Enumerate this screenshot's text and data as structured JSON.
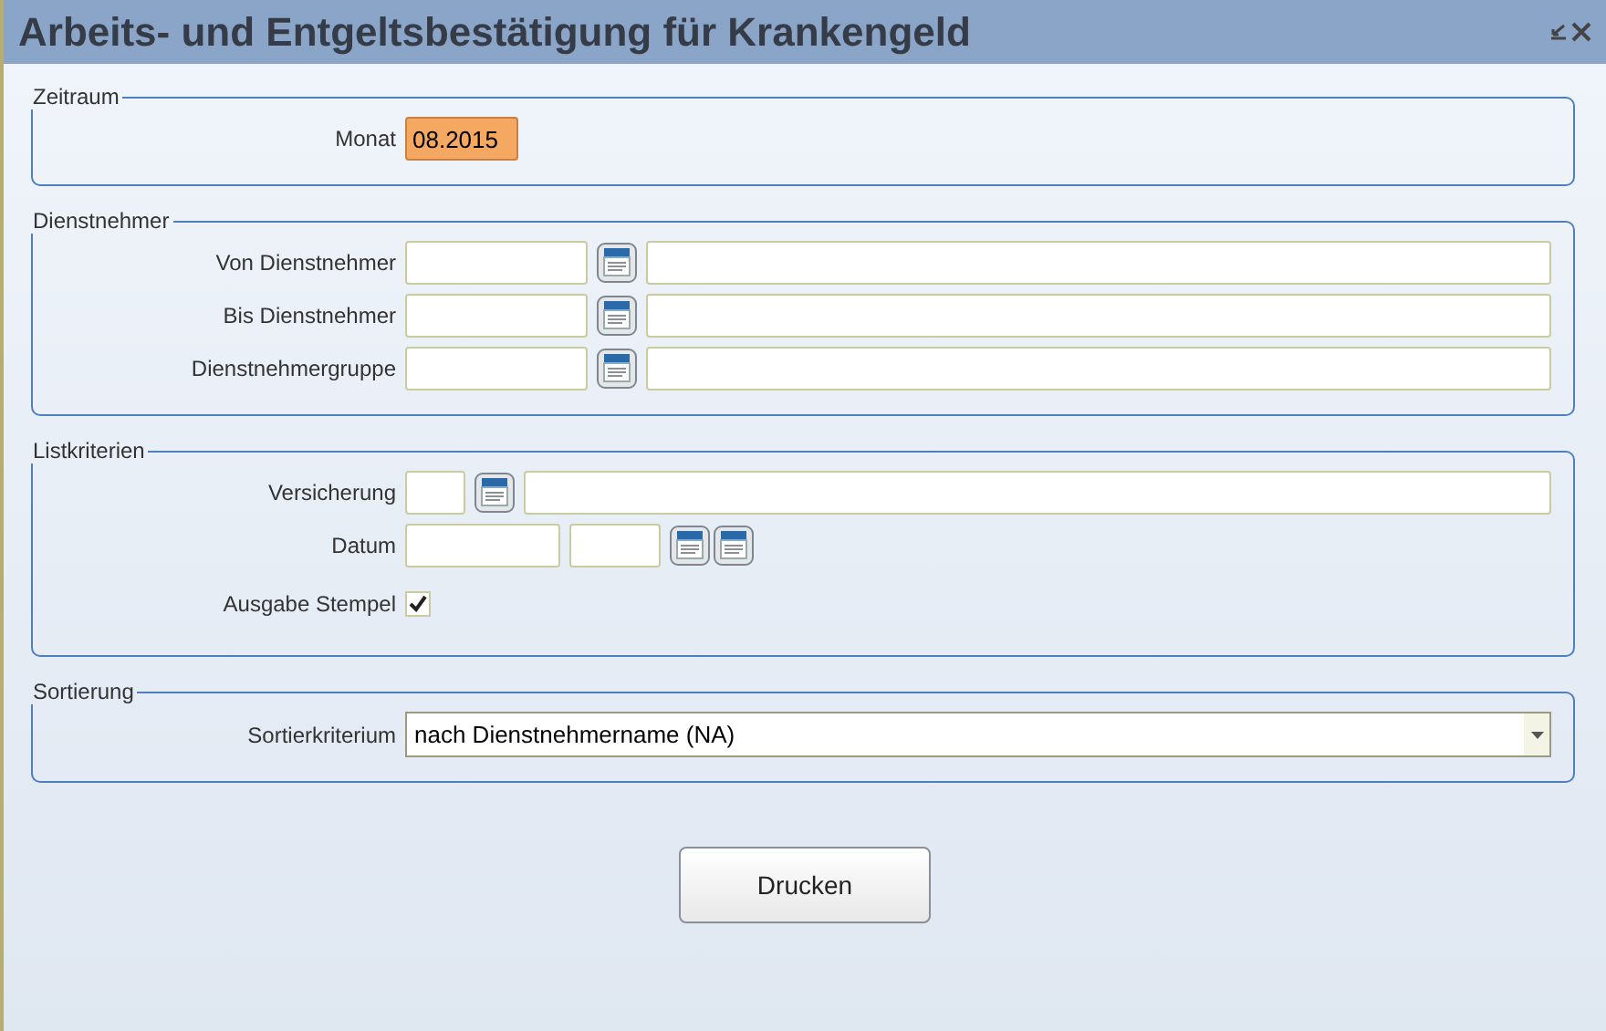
{
  "window": {
    "title": "Arbeits- und Entgeltsbestätigung für Krankengeld"
  },
  "sections": [
    {
      "legend": "Zeitraum",
      "rows": [
        {
          "label": "Monat",
          "controls": [
            {
              "kind": "month",
              "value": "08.2015",
              "highlighted": true
            }
          ]
        }
      ]
    },
    {
      "legend": "Dienstnehmer",
      "rows": [
        {
          "label": "Von Dienstnehmer",
          "controls": [
            {
              "kind": "code",
              "highlighted": false
            },
            {
              "kind": "lookup"
            },
            {
              "kind": "name",
              "highlighted": false
            }
          ]
        },
        {
          "label": "Bis Dienstnehmer",
          "controls": [
            {
              "kind": "code",
              "highlighted": false
            },
            {
              "kind": "lookup"
            },
            {
              "kind": "name",
              "highlighted": false
            }
          ]
        },
        {
          "label": "Dienstnehmergruppe",
          "controls": [
            {
              "kind": "code",
              "highlighted": false
            },
            {
              "kind": "lookup"
            },
            {
              "kind": "name",
              "highlighted": false
            }
          ]
        }
      ]
    },
    {
      "legend": "Listkriterien",
      "rows": [
        {
          "label": "Versicherung",
          "controls": [
            {
              "kind": "tiny",
              "highlighted": false
            },
            {
              "kind": "lookup"
            },
            {
              "kind": "name",
              "highlighted": false
            }
          ]
        },
        {
          "label": "Datum",
          "controls": [
            {
              "kind": "date",
              "highlighted": false
            },
            {
              "kind": "time",
              "highlighted": false
            },
            {
              "kind": "lookup"
            },
            {
              "kind": "lookup"
            }
          ]
        },
        {
          "label": "Ausgabe Stempel",
          "controls": [
            {
              "kind": "checkbox",
              "checked": true
            }
          ]
        }
      ]
    },
    {
      "legend": "Sortierung",
      "rows": [
        {
          "label": "Sortierkriterium",
          "controls": [
            {
              "kind": "select",
              "value": "nach Dienstnehmername (NA)"
            }
          ]
        }
      ]
    }
  ],
  "buttons": [
    {
      "label": "Drucken"
    }
  ]
}
